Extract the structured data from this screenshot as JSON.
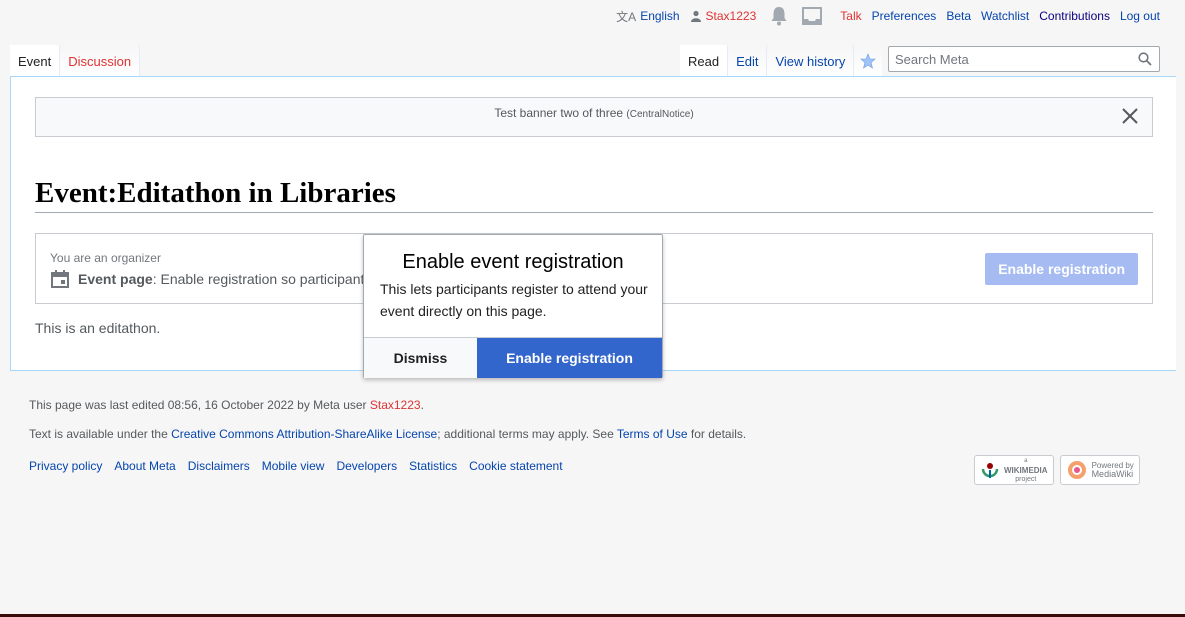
{
  "personal": {
    "language": "English",
    "username": "Stax1223",
    "talk": "Talk",
    "preferences": "Preferences",
    "beta": "Beta",
    "watchlist": "Watchlist",
    "contributions": "Contributions",
    "logout": "Log out"
  },
  "tabs_left": [
    "Event",
    "Discussion"
  ],
  "tabs_right": [
    "Read",
    "Edit",
    "View history"
  ],
  "search": {
    "placeholder": "Search Meta"
  },
  "banner": {
    "text": "Test banner two of three",
    "tag": "(CentralNotice)"
  },
  "page": {
    "title": "Event:Editathon in Libraries",
    "organizer_note": "You are an organizer",
    "event_page_label": "Event page",
    "event_page_text": ": Enable registration so participants can register for your event.",
    "enable_button": "Enable registration",
    "body_text": "This is an editathon."
  },
  "popup": {
    "title": "Enable event registration",
    "body": "This lets participants register to attend your event directly on this page.",
    "dismiss": "Dismiss",
    "enable": "Enable registration"
  },
  "footer": {
    "last_edited_prefix": "This page was last edited 08:56, 16 October 2022 by Meta user ",
    "last_edited_user": "Stax1223",
    "last_edited_suffix": ".",
    "license_prefix": "Text is available under the ",
    "license_link": "Creative Commons Attribution-ShareAlike License",
    "license_mid": "; additional terms may apply. See ",
    "terms_link": "Terms of Use",
    "license_suffix": " for details.",
    "links": [
      "Privacy policy",
      "About Meta",
      "Disclaimers",
      "Mobile view",
      "Developers",
      "Statistics",
      "Cookie statement"
    ],
    "wikimedia_badge": [
      "a",
      "WIKIMEDIA",
      "project"
    ],
    "mediawiki_badge": [
      "Powered by",
      "MediaWiki"
    ]
  },
  "colors": {
    "link": "#0645ad",
    "redlink": "#d33",
    "progressive": "#3366cc",
    "progressive_disabled": "#a6bbf2"
  }
}
